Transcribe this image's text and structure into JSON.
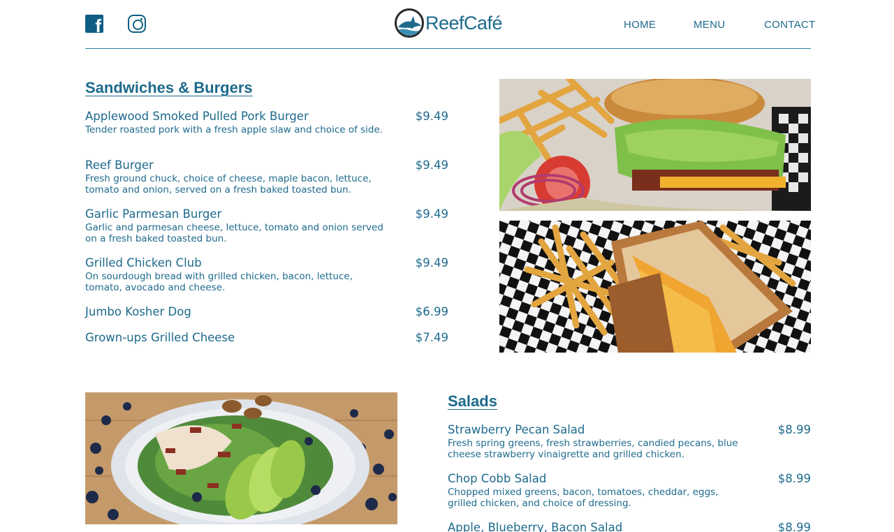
{
  "header": {
    "logo_text": "ReefCafé",
    "nav": {
      "home": "HOME",
      "menu": "MENU",
      "contact": "CONTACT"
    },
    "social": [
      "facebook-icon",
      "instagram-icon"
    ],
    "accent_color": "#1d6a8c"
  },
  "sandwiches": {
    "title": "Sandwiches & Burgers",
    "items": [
      {
        "name": "Applewood Smoked Pulled Pork Burger",
        "desc": "Tender roasted pork with a fresh apple slaw and choice of side.",
        "price": "$9.49"
      },
      {
        "name": "Reef Burger",
        "desc": "Fresh ground chuck, choice of cheese, maple bacon, lettuce, tomato and onion, served on a fresh baked toasted bun.",
        "price": "$9.49"
      },
      {
        "name": "Garlic Parmesan Burger",
        "desc": "Garlic and parmesan cheese, lettuce, tomato and onion served on a fresh baked toasted bun.",
        "price": "$9.49"
      },
      {
        "name": "Grilled Chicken Club",
        "desc": "On sourdough bread with grilled chicken, bacon, lettuce, tomato, avocado and cheese.",
        "price": "$9.49"
      },
      {
        "name": "Jumbo Kosher Dog",
        "desc": "",
        "price": "$6.99"
      },
      {
        "name": "Grown-ups Grilled Cheese",
        "desc": "",
        "price": "$7.49"
      }
    ]
  },
  "salads": {
    "title": "Salads",
    "items": [
      {
        "name": "Strawberry Pecan Salad",
        "desc": "Fresh spring greens, fresh strawberries, candied pecans, blue cheese strawberry vinaigrette and grilled chicken.",
        "price": "$8.99"
      },
      {
        "name": "Chop Cobb Salad",
        "desc": "Chopped mixed greens, bacon, tomatoes, cheddar, eggs, grilled chicken, and choice of dressing.",
        "price": "$8.99"
      },
      {
        "name": "Apple, Blueberry, Bacon Salad",
        "desc": "",
        "price": "$8.99"
      }
    ]
  }
}
